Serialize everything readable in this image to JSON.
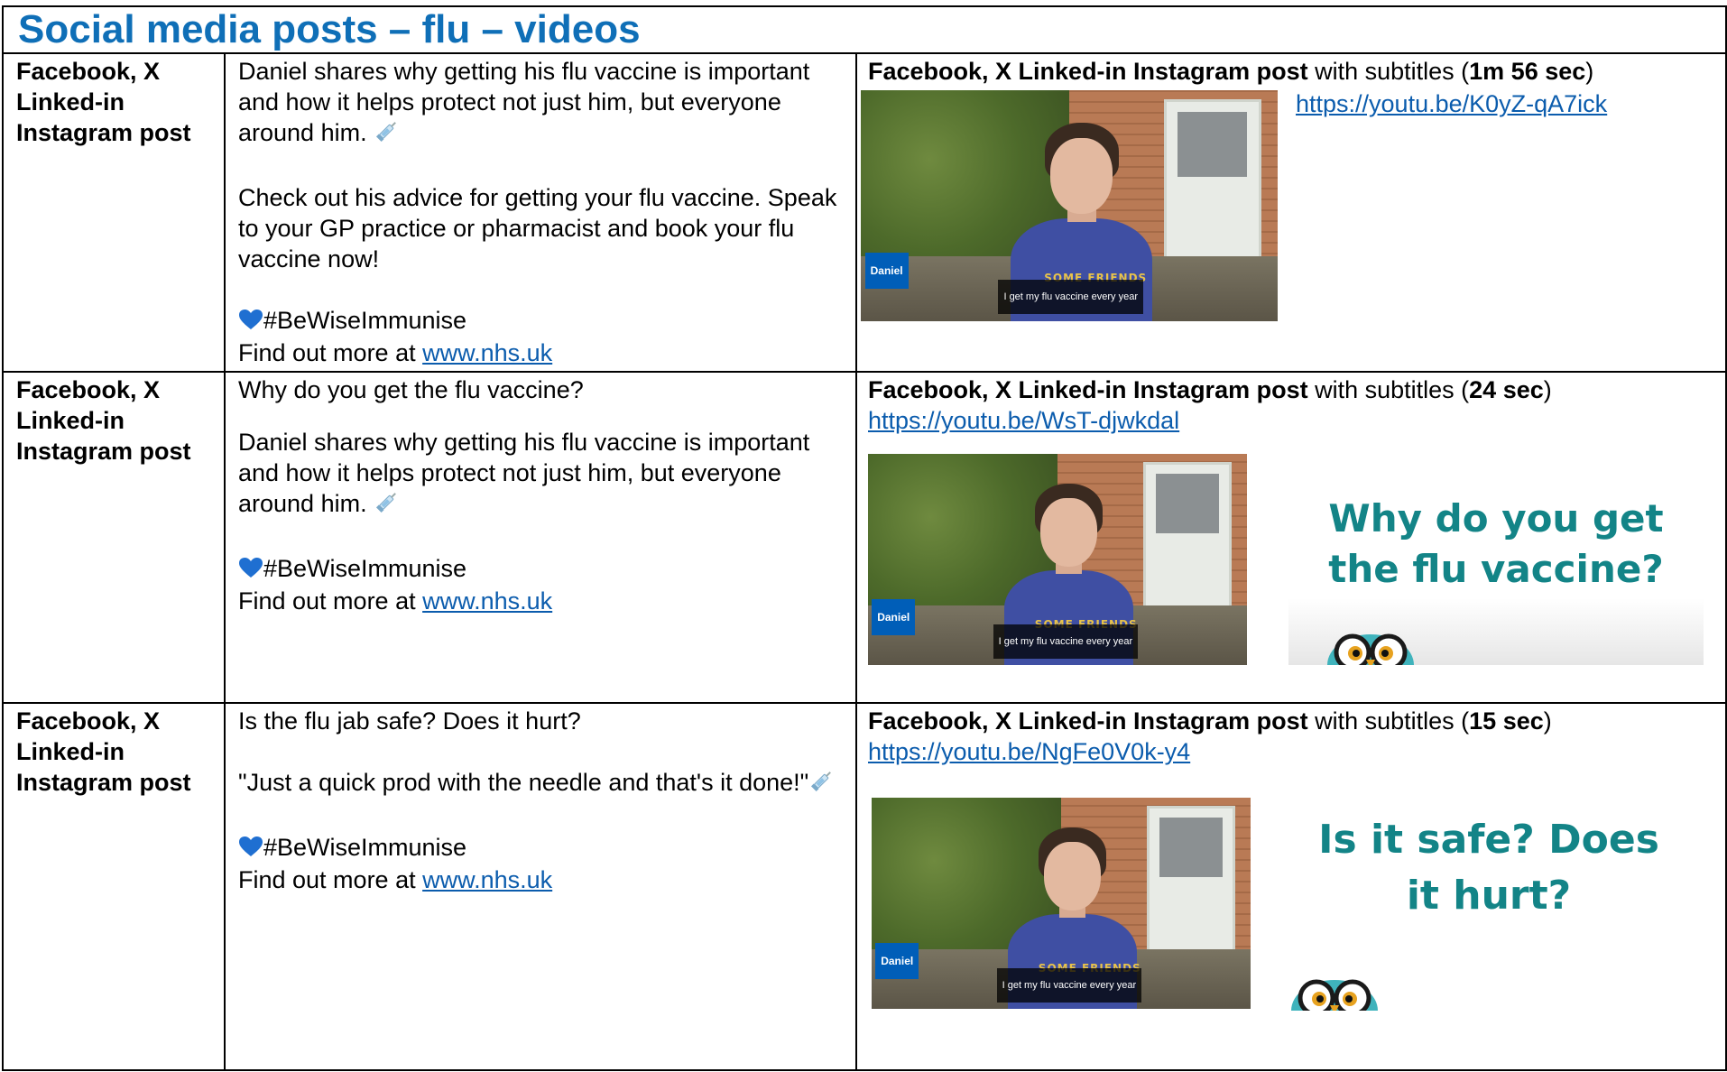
{
  "title": "Social media posts – flu – videos",
  "colors": {
    "title": "#0f6fb7",
    "link": "#0b5cad",
    "card_text": "#138487",
    "nhs_blue": "#005eb8"
  },
  "rows": [
    {
      "platform": [
        "Facebook, X",
        "Linked-in",
        "Instagram post"
      ],
      "copy": {
        "p1": "Daniel shares why getting his flu vaccine is important and how it helps protect not just him, but everyone around him.",
        "p2": "Check out his advice for getting your flu vaccine. Speak to your GP practice or pharmacist and book your flu vaccine now!",
        "hashtag": "#BeWiseImmunise",
        "find_prefix": "Find out more at ",
        "find_link": "www.nhs.uk"
      },
      "media": {
        "heading_bold": "Facebook, X Linked-in Instagram post",
        "heading_mid": " with subtitles (",
        "duration": "1m 56 sec",
        "heading_end": ")",
        "url": "https://youtu.be/K0yZ-qA7ick",
        "thumb_name": "Daniel",
        "thumb_caption": "I get my flu vaccine every year",
        "thumb_shirt": "SOME FRIENDS"
      }
    },
    {
      "platform": [
        "Facebook, X",
        "Linked-in",
        "Instagram post"
      ],
      "copy": {
        "p0": "Why do you get the flu vaccine?",
        "p1": "Daniel shares why getting his flu vaccine is important and how it helps protect not just him, but everyone around him.",
        "hashtag": "#BeWiseImmunise",
        "find_prefix": "Find out more at ",
        "find_link": "www.nhs.uk"
      },
      "media": {
        "heading_bold": "Facebook, X Linked-in Instagram post",
        "heading_mid": " with subtitles (",
        "duration": "24 sec",
        "heading_end": ")",
        "url": "https://youtu.be/WsT-djwkdal",
        "thumb_name": "Daniel",
        "thumb_caption": "I get my flu vaccine every year",
        "thumb_shirt": "SOME FRIENDS",
        "card_line1": "Why do you get",
        "card_line2": "the flu vaccine?"
      }
    },
    {
      "platform": [
        "Facebook, X",
        "Linked-in",
        "Instagram post"
      ],
      "copy": {
        "p0": "Is the flu jab safe? Does it hurt?",
        "p1": "\"Just a quick prod with the needle and that's it done!\"",
        "hashtag": "#BeWiseImmunise",
        "find_prefix": "Find out more at ",
        "find_link": "www.nhs.uk"
      },
      "media": {
        "heading_bold": "Facebook, X Linked-in Instagram post",
        "heading_mid": " with subtitles (",
        "duration": "15 sec",
        "heading_end": ")",
        "url": "https://youtu.be/NgFe0V0k-y4",
        "thumb_name": "Daniel",
        "thumb_caption": "I get my flu vaccine every year",
        "thumb_shirt": "SOME FRIENDS",
        "card_line1": "Is it safe? Does",
        "card_line2": "it hurt?"
      }
    }
  ]
}
